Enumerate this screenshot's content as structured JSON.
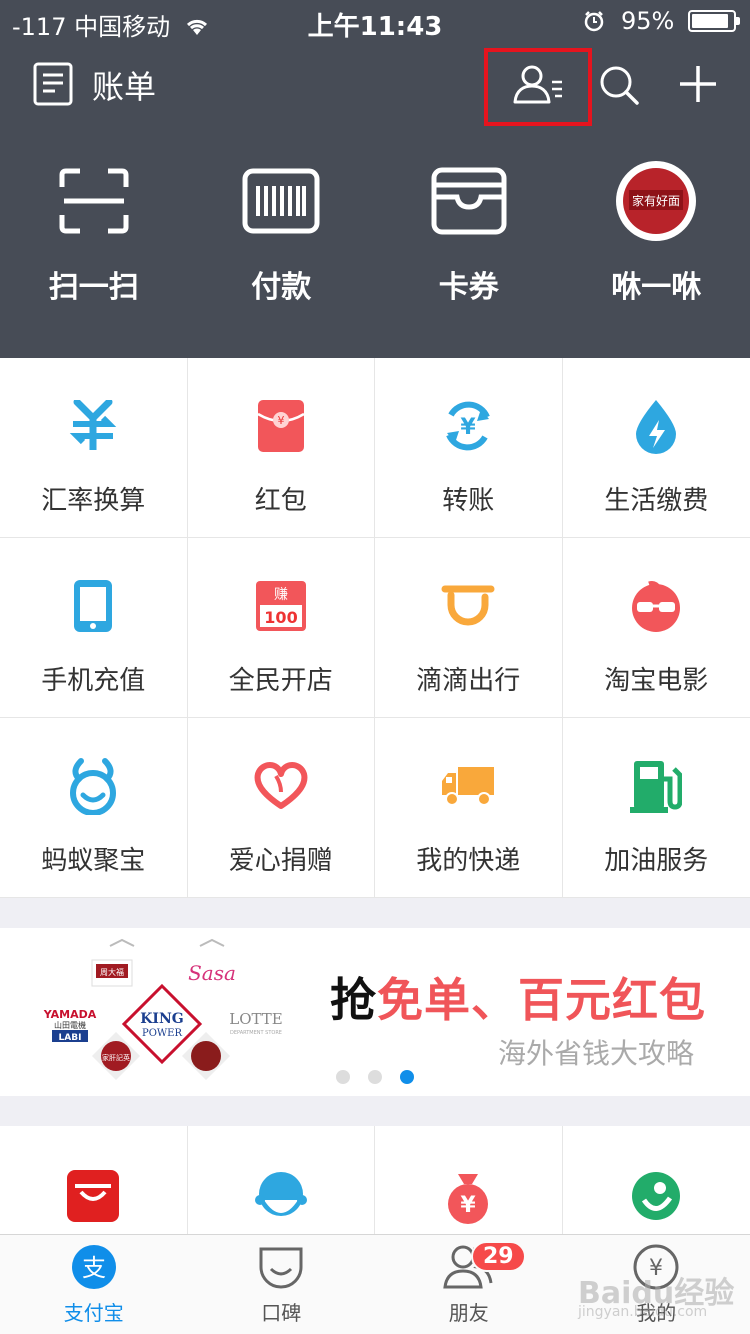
{
  "status": {
    "carrier": "-117 中国移动",
    "time": "上午11:43",
    "battery": "95%",
    "battery_level_pct": 95
  },
  "header": {
    "title": "账单",
    "icons": [
      "bill-list-icon",
      "contacts-icon",
      "search-icon",
      "plus-icon"
    ]
  },
  "quick": [
    {
      "label": "扫一扫",
      "icon": "scan-icon"
    },
    {
      "label": "付款",
      "icon": "barcode-pay-icon"
    },
    {
      "label": "卡券",
      "icon": "wallet-icon"
    },
    {
      "label": "咻一咻",
      "icon": "xiu-promo-icon",
      "logo_text": "家有好面"
    }
  ],
  "services": [
    {
      "label": "汇率换算",
      "icon": "currency-exchange-icon"
    },
    {
      "label": "红包",
      "icon": "red-envelope-icon"
    },
    {
      "label": "转账",
      "icon": "transfer-icon"
    },
    {
      "label": "生活缴费",
      "icon": "utility-bill-icon"
    },
    {
      "label": "手机充值",
      "icon": "phone-recharge-icon"
    },
    {
      "label": "全民开店",
      "icon": "open-store-icon",
      "icon_text_top": "赚",
      "icon_text_bottom": "100"
    },
    {
      "label": "滴滴出行",
      "icon": "didi-icon"
    },
    {
      "label": "淘宝电影",
      "icon": "taobao-movie-icon"
    },
    {
      "label": "蚂蚁聚宝",
      "icon": "ant-fortune-icon"
    },
    {
      "label": "爱心捐赠",
      "icon": "donation-heart-icon"
    },
    {
      "label": "我的快递",
      "icon": "express-truck-icon"
    },
    {
      "label": "加油服务",
      "icon": "gas-station-icon"
    }
  ],
  "banner": {
    "headline_prefix": "抢",
    "headline_highlight": "免单、百元红包",
    "subtitle": "海外省钱大攻略",
    "logos": [
      "周大福",
      "Sasa",
      "YAMADA",
      "山田電機",
      "LABI",
      "KING",
      "POWER",
      "LOTTE",
      "DEPARTMENT STORE",
      "家肝記英"
    ],
    "page_count": 3,
    "active_page": 3
  },
  "services_row2": [
    "tmall-icon",
    "customer-service-icon",
    "money-bag-icon",
    "green-app-icon"
  ],
  "tabs": [
    {
      "label": "支付宝",
      "icon": "alipay-icon",
      "active": true,
      "glyph": "支"
    },
    {
      "label": "口碑",
      "icon": "koubei-icon",
      "active": false
    },
    {
      "label": "朋友",
      "icon": "friends-icon",
      "active": false,
      "badge": "29"
    },
    {
      "label": "我的",
      "icon": "profile-yuan-icon",
      "active": false,
      "glyph": "¥"
    }
  ],
  "watermark": {
    "text": "Baidu经验",
    "url": "jingyan.baidu.com"
  },
  "colors": {
    "header_bg": "#474c56",
    "accent_blue": "#108ee9",
    "accent_red": "#f05559",
    "highlight_box": "#e6141e"
  }
}
